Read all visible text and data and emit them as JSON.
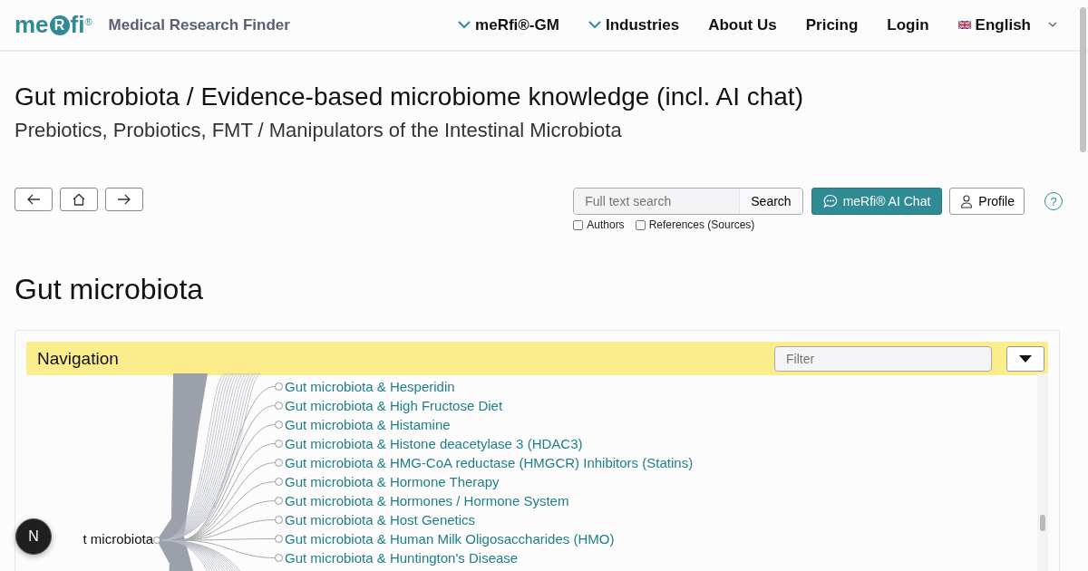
{
  "header": {
    "logo": "meRfi",
    "logo_mark": "®",
    "site_name": "Medical Research Finder",
    "nav": [
      {
        "label": "meRfi®-GM",
        "kind": "dropdown"
      },
      {
        "label": "Industries",
        "kind": "dropdown"
      },
      {
        "label": "About Us",
        "kind": "link"
      },
      {
        "label": "Pricing",
        "kind": "link"
      },
      {
        "label": "Login",
        "kind": "link"
      },
      {
        "label": "English",
        "kind": "language"
      }
    ]
  },
  "title": "Gut microbiota / Evidence-based microbiome knowledge (incl. AI chat)",
  "subtitle": "Prebiotics, Probiotics, FMT / Manipulators of the Intestinal Microbiota",
  "toolbar": {
    "nav_buttons": [
      {
        "kind": "back"
      },
      {
        "kind": "home"
      },
      {
        "kind": "forward"
      }
    ],
    "search": {
      "placeholder": "Full text search",
      "button": "Search"
    },
    "options": [
      {
        "label": "Authors",
        "checked": false
      },
      {
        "label": "References (Sources)",
        "checked": false
      }
    ],
    "ai_chat": "meRfi® AI Chat",
    "profile": "Profile",
    "help": "?"
  },
  "heading": "Gut microbiota",
  "navigation": {
    "title": "Navigation",
    "filter_placeholder": "Filter",
    "root": "t microbiota",
    "items": [
      "Gut microbiota & Hesperidin",
      "Gut microbiota & High Fructose Diet",
      "Gut microbiota & Histamine",
      "Gut microbiota & Histone deacetylase 3 (HDAC3)",
      "Gut microbiota & HMG-CoA reductase (HMGCR) Inhibitors (Statins)",
      "Gut microbiota & Hormone Therapy",
      "Gut microbiota & Hormones / Hormone System",
      "Gut microbiota & Host Genetics",
      "Gut microbiota & Human Milk Oligosaccharides (HMO)",
      "Gut microbiota & Huntington's Disease"
    ]
  },
  "floating_badge": "N"
}
